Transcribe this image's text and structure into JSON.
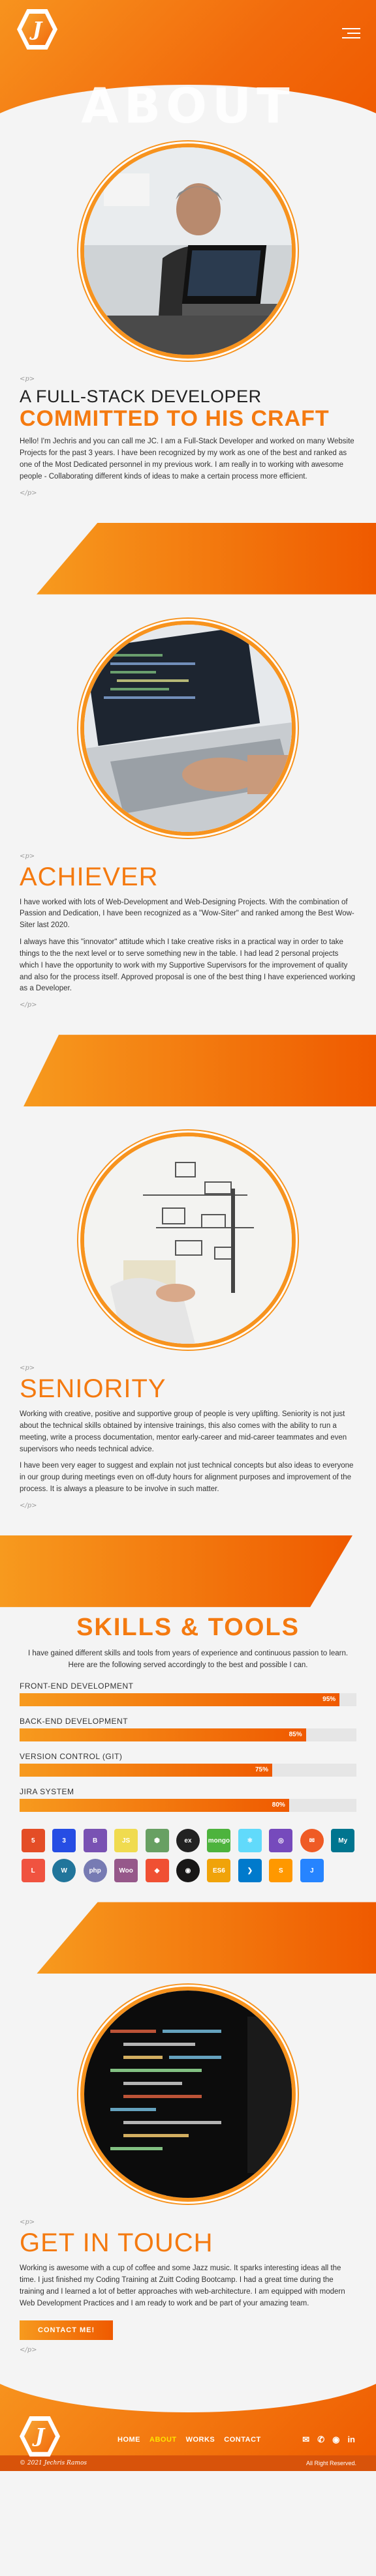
{
  "header": {
    "logo_letter": "J",
    "hero_title": "ABOUT"
  },
  "intro": {
    "tag_open": "<p>",
    "kicker": "A FULL-STACK DEVELOPER",
    "title": "COMMITTED TO HIS CRAFT",
    "text": "Hello! I'm Jechris and you can call me JC. I am a Full-Stack Developer and worked on many Website Projects for the past 3 years. I have been recognized by my work as one of the best and ranked as one of the Most Dedicated personnel in my previous work. I am really in to working with awesome people - Collaborating different kinds of ideas to make a certain process more efficient.",
    "tag_close": "</p>"
  },
  "achiever": {
    "tag_open": "<p>",
    "title": "ACHIEVER",
    "text1": "I have worked with lots of Web-Development and Web-Designing Projects. With the combination of Passion and Dedication, I have been recognized as a \"Wow-Siter\" and ranked among the Best Wow-Siter last 2020.",
    "text2": "I always have this \"innovator\" attitude which I take creative risks in a practical way in order to take things to the the next level or to serve something new in the table. I had lead 2 personal projects which I have the opportunity to work with my Supportive Supervisors for the improvement of quality and also for the process itself. Approved proposal is one of the best thing I have experienced working as a Developer.",
    "tag_close": "</p>"
  },
  "seniority": {
    "tag_open": "<p>",
    "title": "SENIORITY",
    "text1": "Working with creative, positive and supportive group of people is very uplifting. Seniority is not just about the technical skills obtained by intensive trainings, this also comes with the ability to run a meeting, write a process documentation, mentor early-career and mid-career teammates and even supervisors who needs technical advice.",
    "text2": "I have been very eager to suggest and explain not just technical concepts but also ideas to everyone in our group during meetings even on off-duty hours for alignment purposes and improvement of the process. It is always a pleasure to be involve in such matter.",
    "tag_close": "</p>"
  },
  "skills": {
    "title": "SKILLS & TOOLS",
    "intro": "I have gained different skills and tools from years of experience and continuous passion to learn. Here are the following served accordingly to the best and possible I can.",
    "items": [
      {
        "label": "FRONT-END DEVELOPMENT",
        "pct": "95%",
        "value": 95
      },
      {
        "label": "BACK-END DEVELOPMENT",
        "pct": "85%",
        "value": 85
      },
      {
        "label": "VERSION CONTROL (GIT)",
        "pct": "75%",
        "value": 75
      },
      {
        "label": "JIRA SYSTEM",
        "pct": "80%",
        "value": 80
      }
    ],
    "tech": [
      {
        "name": "html5-icon",
        "glyph": "5",
        "color": "#e44d26",
        "round": false
      },
      {
        "name": "css3-icon",
        "glyph": "3",
        "color": "#264de4",
        "round": false
      },
      {
        "name": "bootstrap-icon",
        "glyph": "B",
        "color": "#7952b3",
        "round": false
      },
      {
        "name": "javascript-icon",
        "glyph": "JS",
        "color": "#f0db4f",
        "round": false
      },
      {
        "name": "nodejs-icon",
        "glyph": "⬢",
        "color": "#68a063",
        "round": false
      },
      {
        "name": "express-icon",
        "glyph": "ex",
        "color": "#222222",
        "round": true
      },
      {
        "name": "mongodb-icon",
        "glyph": "mongo",
        "color": "#4db33d",
        "round": false
      },
      {
        "name": "react-icon",
        "glyph": "⚛",
        "color": "#61dafb",
        "round": false
      },
      {
        "name": "redux-icon",
        "glyph": "◎",
        "color": "#764abc",
        "round": false
      },
      {
        "name": "postman-icon",
        "glyph": "✉",
        "color": "#ef5b25",
        "round": true
      },
      {
        "name": "mysql-icon",
        "glyph": "My",
        "color": "#00758f",
        "round": false
      },
      {
        "name": "laravel-icon",
        "glyph": "L",
        "color": "#f05340",
        "round": false
      },
      {
        "name": "wordpress-icon",
        "glyph": "W",
        "color": "#21759b",
        "round": true
      },
      {
        "name": "php-icon",
        "glyph": "php",
        "color": "#777bb3",
        "round": true
      },
      {
        "name": "woocommerce-icon",
        "glyph": "Woo",
        "color": "#96588a",
        "round": false
      },
      {
        "name": "git-icon",
        "glyph": "◆",
        "color": "#f05033",
        "round": false
      },
      {
        "name": "github-icon",
        "glyph": "◉",
        "color": "#181717",
        "round": true
      },
      {
        "name": "es6-icon",
        "glyph": "ES6",
        "color": "#f0a30a",
        "round": false
      },
      {
        "name": "vscode-icon",
        "glyph": "❯",
        "color": "#007acc",
        "round": false
      },
      {
        "name": "sublime-icon",
        "glyph": "S",
        "color": "#ff9800",
        "round": false
      },
      {
        "name": "jira-icon",
        "glyph": "J",
        "color": "#2684ff",
        "round": false
      }
    ]
  },
  "contact": {
    "tag_open": "<p>",
    "title": "GET IN TOUCH",
    "text": "Working is awesome with a cup of coffee and some Jazz music. It sparks interesting ideas all the time. I just finished my Coding Training at Zuitt Coding Bootcamp. I had a great time during the training and I learned a lot of better approaches with web-architecture. I am equipped with modern Web Development Practices and I am ready to work and be part of your amazing team.",
    "button": "CONTACT ME!",
    "tag_close": "</p>"
  },
  "footer": {
    "nav": [
      {
        "label": "HOME",
        "active": false
      },
      {
        "label": "ABOUT",
        "active": true
      },
      {
        "label": "WORKS",
        "active": false
      },
      {
        "label": "CONTACT",
        "active": false
      }
    ],
    "social": [
      {
        "name": "email-icon",
        "glyph": "✉"
      },
      {
        "name": "mobile-icon",
        "glyph": "✆"
      },
      {
        "name": "github-icon",
        "glyph": "◉"
      },
      {
        "name": "linkedin-icon",
        "glyph": "in"
      }
    ],
    "signature": "© 2021 Jechris Ramos",
    "rights": "All Right Reserved."
  }
}
